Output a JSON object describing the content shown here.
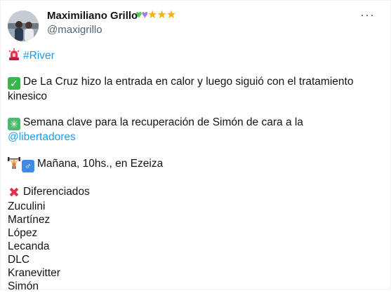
{
  "author": {
    "name": "Maximiliano Grillo",
    "handle": "@maxigrillo",
    "badges": [
      "green-heart",
      "purple-heart",
      "star",
      "star",
      "star"
    ]
  },
  "menu": {
    "more_label": "···"
  },
  "tweet": {
    "hashtag": "#River",
    "line_1": "De La Cruz hizo la entrada en calor y luego siguió con el tratamiento kinesico",
    "line_2_text": "Semana clave para la recuperación de Simón de cara a la",
    "line_2_mention": "@libertadores",
    "line_3": "Mañana, 10hs., en Ezeiza",
    "list_title": "Diferenciados",
    "players": [
      "Zuculini",
      "Martínez",
      "López",
      "Lecanda",
      "DLC",
      "Kranevitter",
      "Simón"
    ]
  },
  "colors": {
    "link": "#1d9bf0",
    "secondary_text": "#536471",
    "primary_text": "#0f1419"
  },
  "icons": {
    "siren": "police-light-icon",
    "check": "white-check-mark-icon",
    "sparkle": "eight-spoked-asterisk-icon",
    "weightlifter": "weight-lifter-icon",
    "male": "male-sign-icon",
    "cross": "cross-mark-icon"
  }
}
